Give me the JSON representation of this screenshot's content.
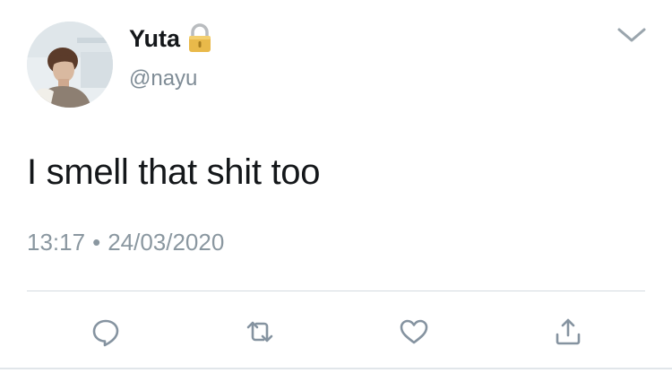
{
  "profile": {
    "display_name": "Yuta",
    "handle": "@nayu",
    "avatar_icon": "avatar-photo",
    "lock_icon": "lock-icon"
  },
  "tweet": {
    "text": "I smell that shit too",
    "time": "13:17",
    "separator": "•",
    "date": "24/03/2020"
  },
  "actions": [
    {
      "name": "reply",
      "icon": "speech-bubble-icon"
    },
    {
      "name": "retweet",
      "icon": "retweet-icon"
    },
    {
      "name": "like",
      "icon": "heart-icon"
    },
    {
      "name": "share",
      "icon": "share-icon"
    }
  ],
  "menu": {
    "icon": "chevron-down-icon"
  },
  "colors": {
    "text_primary": "#14171a",
    "text_secondary": "#8a97a0",
    "icon_gray": "#7f8c96",
    "divider": "#d4dbe0"
  }
}
